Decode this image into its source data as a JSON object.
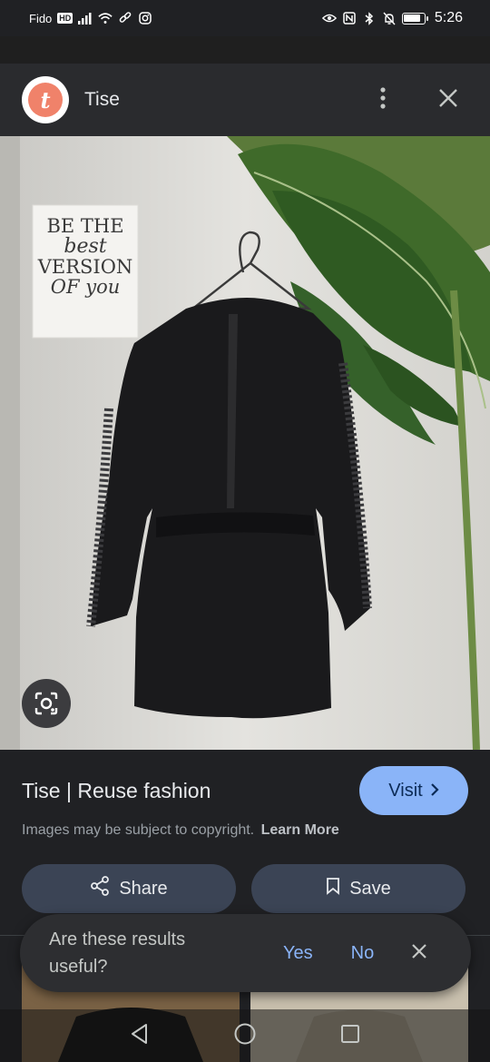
{
  "status_bar": {
    "carrier": "Fido",
    "hd_badge": "HD",
    "time": "5:26",
    "battery_level": 0.85,
    "icons": [
      "signal-icon",
      "wifi-icon",
      "link-icon",
      "instagram-icon",
      "eye-icon",
      "nfc-icon",
      "bluetooth-icon",
      "bell-off-icon",
      "battery-icon"
    ]
  },
  "header": {
    "logo_letter": "t",
    "site_name": "Tise",
    "icons": [
      "more-vert-icon",
      "close-icon"
    ]
  },
  "image": {
    "sign_lines": [
      "BE THE",
      "best",
      "VERSION",
      "OF you"
    ]
  },
  "result": {
    "title": "Tise | Reuse fashion",
    "visit_label": "Visit",
    "copyright_text": "Images may be subject to copyright.",
    "learn_more_label": "Learn More",
    "share_label": "Share",
    "save_label": "Save"
  },
  "feedback": {
    "question": "Are these results useful?",
    "yes_label": "Yes",
    "no_label": "No"
  },
  "colors": {
    "accent": "#8ab4f8",
    "button_bg": "#3b4455",
    "logo_brand": "#f0826a",
    "panel_bg": "#202124"
  }
}
